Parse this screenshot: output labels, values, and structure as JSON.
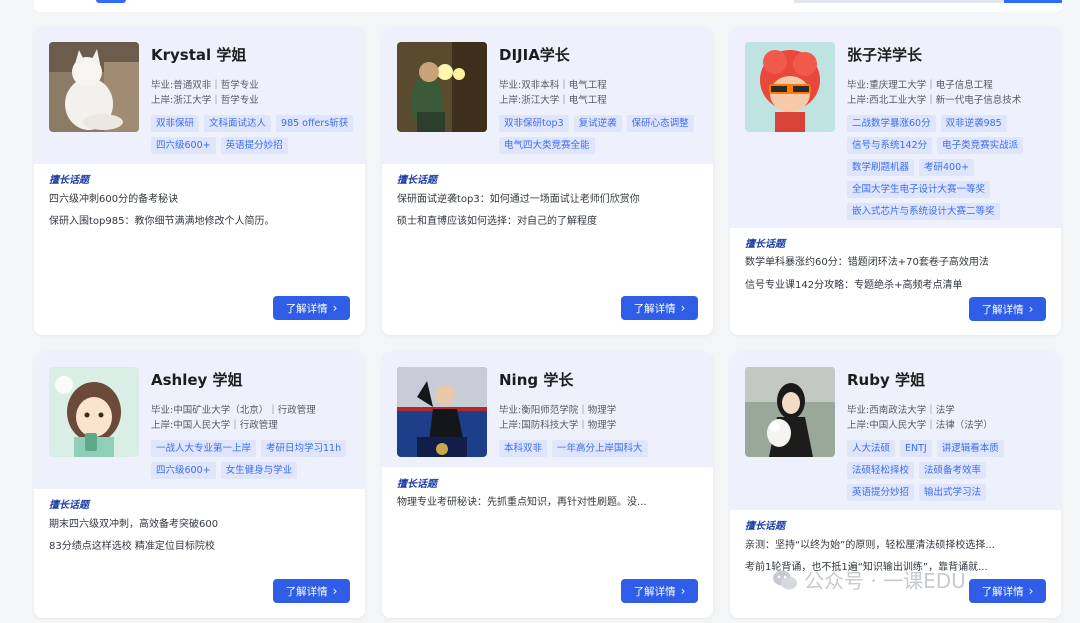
{
  "topic_heading": "擅长话题",
  "button_label": "了解详情",
  "mentors": [
    {
      "name": "Krystal 学姐",
      "grad": "毕业:普通双非｜哲学专业",
      "current": "上岸:浙江大学｜哲学专业",
      "tags": [
        "双非保研",
        "文科面试达人",
        "985 offers斩获",
        "四六级600+",
        "英语提分妙招"
      ],
      "topics": [
        "四六级冲刺600分的备考秘诀",
        "保研入围top985：教你细节满满地修改个人简历。"
      ]
    },
    {
      "name": "DIJIA学长",
      "grad": "毕业:双非本科｜电气工程",
      "current": "上岸:浙江大学｜电气工程",
      "tags": [
        "双非保研top3",
        "复试逆袭",
        "保研心态调整",
        "电气四大类竞赛全能"
      ],
      "topics": [
        "保研面试逆袭top3：如何通过一场面试让老师们欣赏你",
        "硕士和直博应该如何选择：对自己的了解程度"
      ]
    },
    {
      "name": "张子洋学长",
      "grad": "毕业:重庆理工大学｜电子信息工程",
      "current": "上岸:西北工业大学｜新一代电子信息技术",
      "tags": [
        "二战数学暴涨60分",
        "双非逆袭985",
        "信号与系统142分",
        "电子类竞赛实战派",
        "数学刷题机器",
        "考研400+",
        "全国大学生电子设计大赛一等奖",
        "嵌入式芯片与系统设计大赛二等奖"
      ],
      "topics": [
        "数学单科暴涨约60分：错题闭环法+70套卷子高效用法",
        "信号专业课142分攻略：专题绝杀+高频考点清单"
      ]
    },
    {
      "name": "Ashley 学姐",
      "grad": "毕业:中国矿业大学（北京）｜行政管理",
      "current": "上岸:中国人民大学｜行政管理",
      "tags": [
        "一战人大专业第一上岸",
        "考研日均学习11h",
        "四六级600+",
        "女生健身与学业"
      ],
      "topics": [
        "期末四六级双冲刺，高效备考突破600",
        "83分绩点这样选校 精准定位目标院校"
      ]
    },
    {
      "name": "Ning 学长",
      "grad": "毕业:衡阳师范学院｜物理学",
      "current": "上岸:国防科技大学｜物理学",
      "tags": [
        "本科双非",
        "一年高分上岸国科大"
      ],
      "topics": [
        "物理专业考研秘诀：先抓重点知识，再针对性刷题。没..."
      ]
    },
    {
      "name": "Ruby 学姐",
      "grad": "毕业:西南政法大学｜法学",
      "current": "上岸:中国人民大学｜法律（法学）",
      "tags": [
        "人大法硕",
        "ENTJ",
        "讲逻辑看本质",
        "法硕轻松择校",
        "法硕备考效率",
        "英语提分妙招",
        "输出式学习法"
      ],
      "topics": [
        "亲测：坚持“以终为始”的原则，轻松厘清法硕择校选择...",
        "考前1轮背诵，也不抵1遍“知识输出训练”，靠背诵就..."
      ]
    }
  ],
  "watermark": "公众号 · 一课EDU"
}
